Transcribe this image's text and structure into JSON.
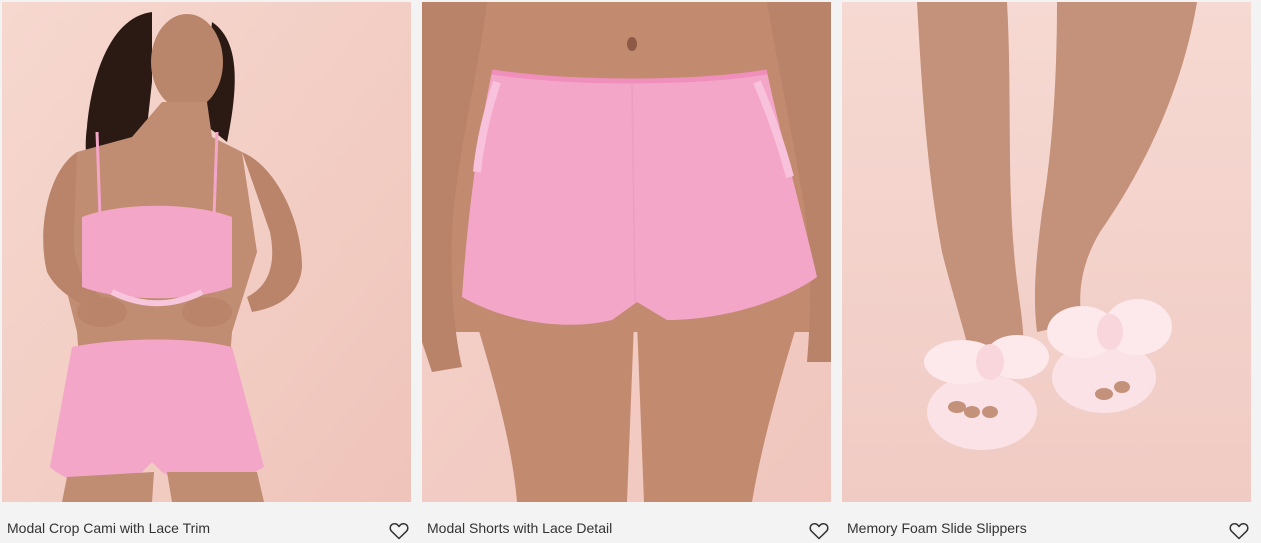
{
  "products": [
    {
      "title": "Modal Crop Cami with Lace Trim",
      "favorite_icon": "heart-outline-icon"
    },
    {
      "title": "Modal Shorts with Lace Detail",
      "favorite_icon": "heart-outline-icon"
    },
    {
      "title": "Memory Foam Slide Slippers",
      "favorite_icon": "heart-outline-icon"
    }
  ],
  "colors": {
    "background": "#f3f3f3",
    "text": "#333333",
    "photo_background": "#f3cfc6",
    "garment_pink": "#f4a6c9",
    "slipper_pink": "#fbe2e6"
  }
}
